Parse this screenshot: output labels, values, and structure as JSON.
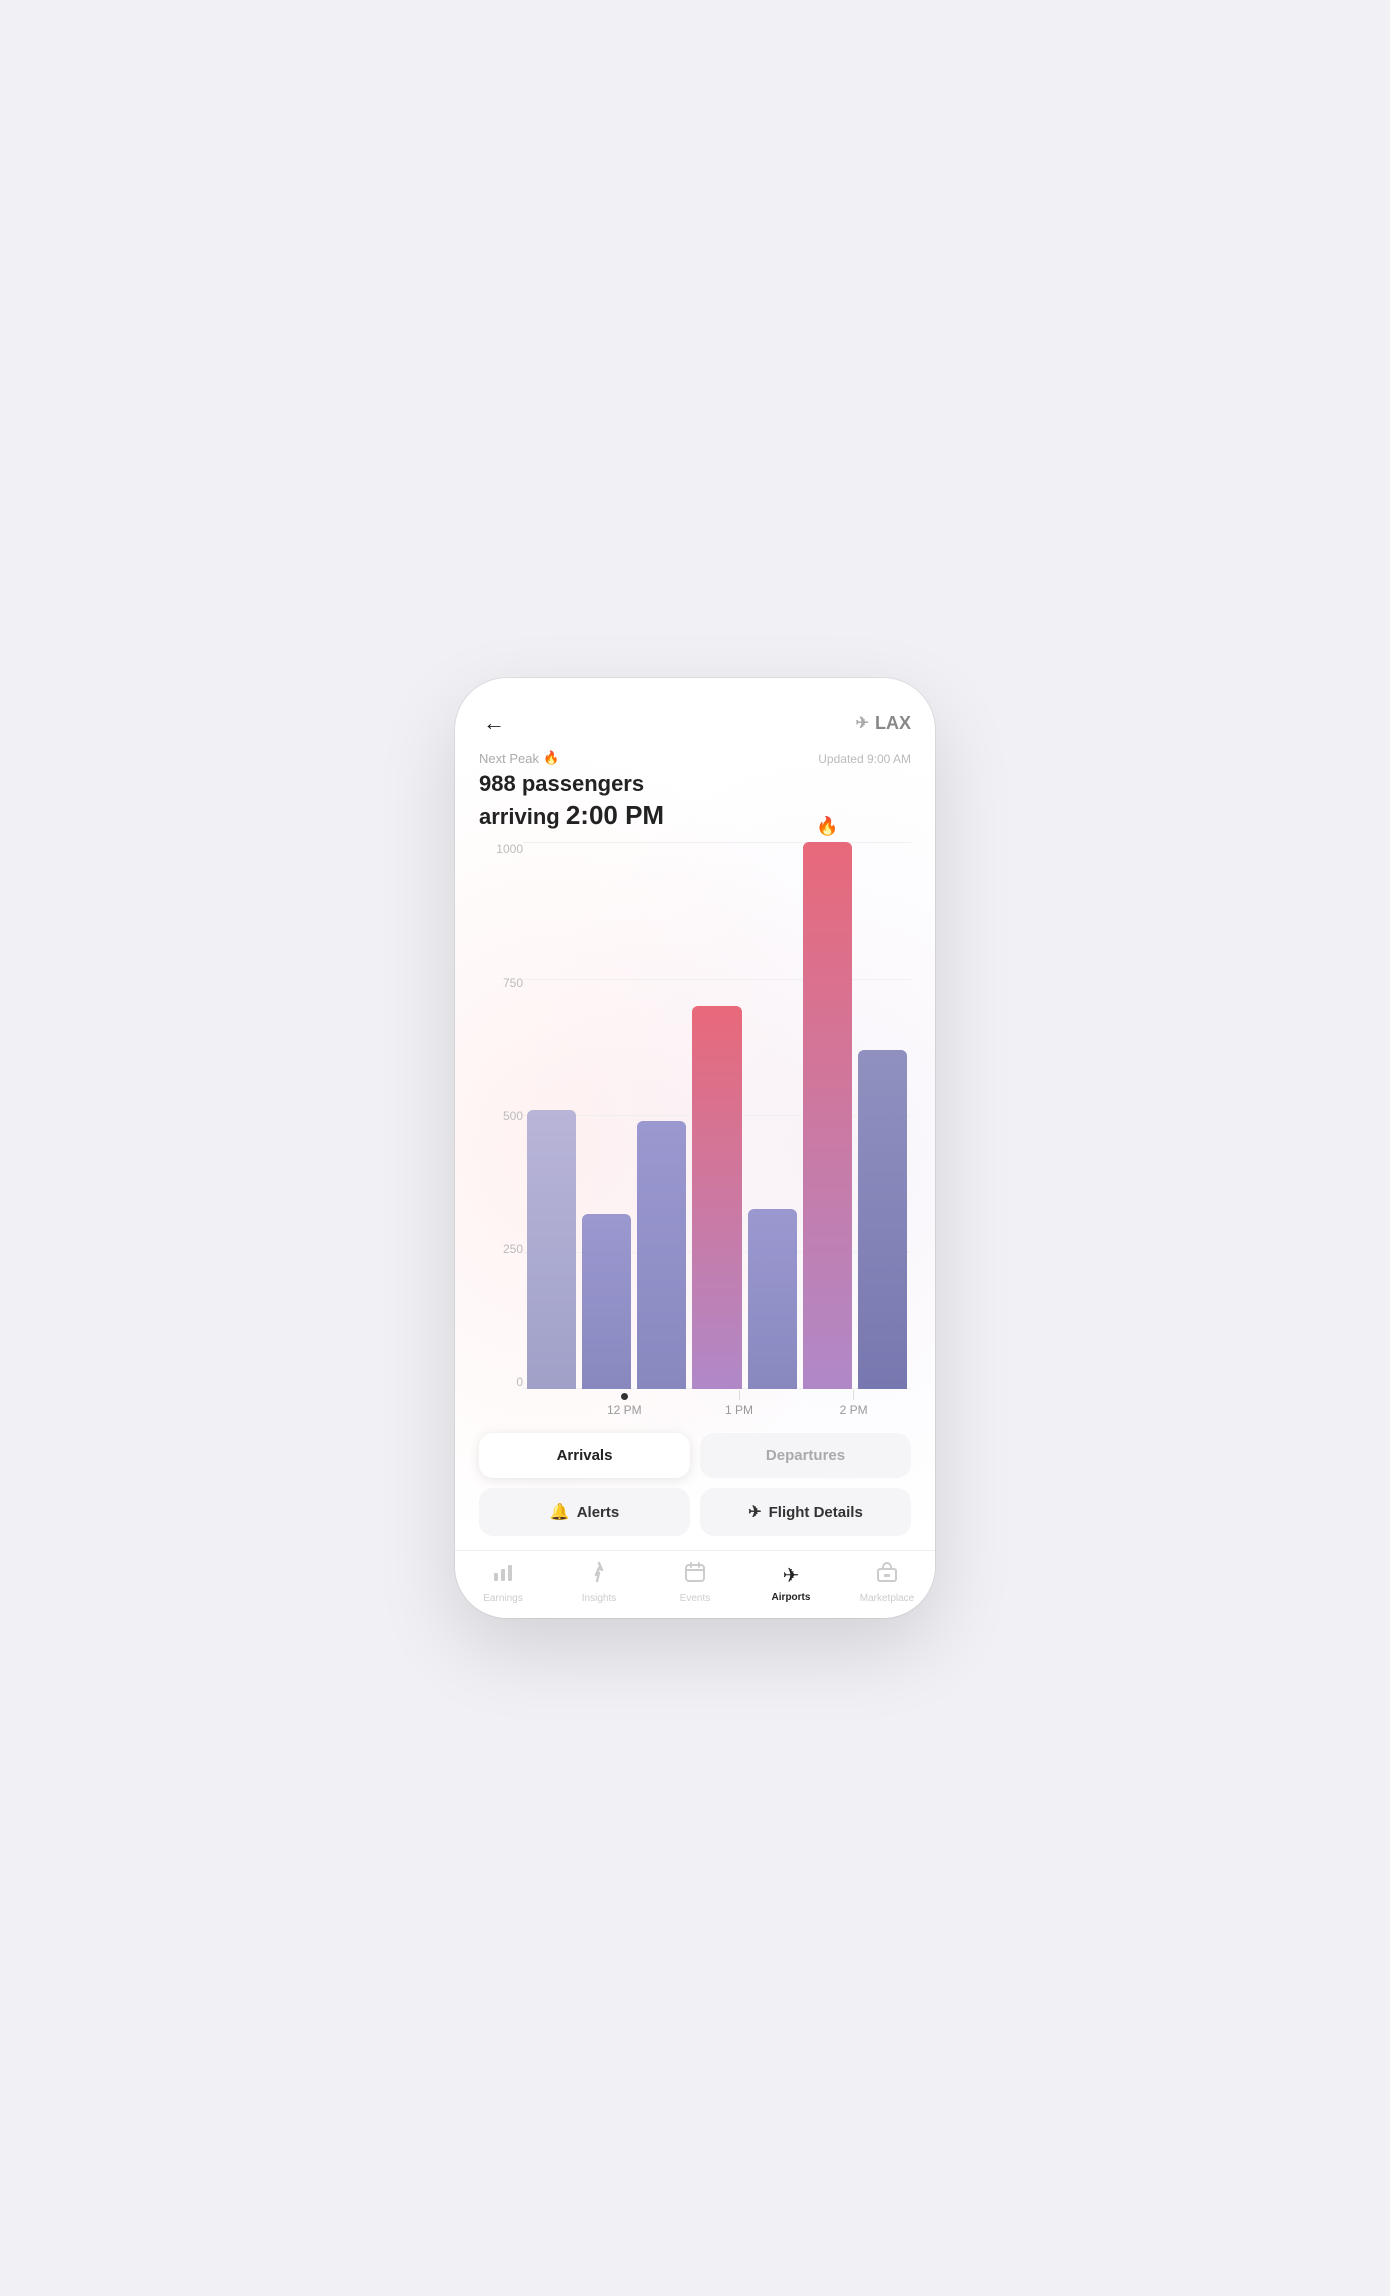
{
  "header": {
    "back_label": "←",
    "airport_code": "LAX",
    "updated_text": "Updated 9:00 AM"
  },
  "peak_info": {
    "next_peak_label": "Next Peak",
    "passengers": "988 passengers",
    "arriving_text": "arriving",
    "peak_time": "2:00 PM"
  },
  "chart": {
    "y_labels": [
      "1000",
      "750",
      "500",
      "250",
      "0"
    ],
    "x_labels": [
      "12 PM",
      "1 PM",
      "2 PM"
    ],
    "bars": [
      {
        "height_pct": 51,
        "type": "purple-light",
        "fire": false
      },
      {
        "height_pct": 32,
        "type": "purple-medium",
        "fire": false
      },
      {
        "height_pct": 49,
        "type": "purple-medium",
        "fire": false
      },
      {
        "height_pct": 70,
        "type": "pink-hot",
        "fire": false
      },
      {
        "height_pct": 33,
        "type": "purple-medium",
        "fire": false
      },
      {
        "height_pct": 100,
        "type": "pink-hot",
        "fire": true
      },
      {
        "height_pct": 62,
        "type": "purple-dark",
        "fire": false
      }
    ]
  },
  "tabs": {
    "arrivals_label": "Arrivals",
    "departures_label": "Departures"
  },
  "actions": {
    "alerts_label": "Alerts",
    "flight_details_label": "Flight Details"
  },
  "bottom_nav": {
    "items": [
      {
        "label": "Earnings",
        "icon": "📊",
        "active": false
      },
      {
        "label": "Insights",
        "icon": "⚡",
        "active": false
      },
      {
        "label": "Events",
        "icon": "📅",
        "active": false
      },
      {
        "label": "Airports",
        "icon": "✈",
        "active": true
      },
      {
        "label": "Marketplace",
        "icon": "🏪",
        "active": false
      }
    ]
  }
}
